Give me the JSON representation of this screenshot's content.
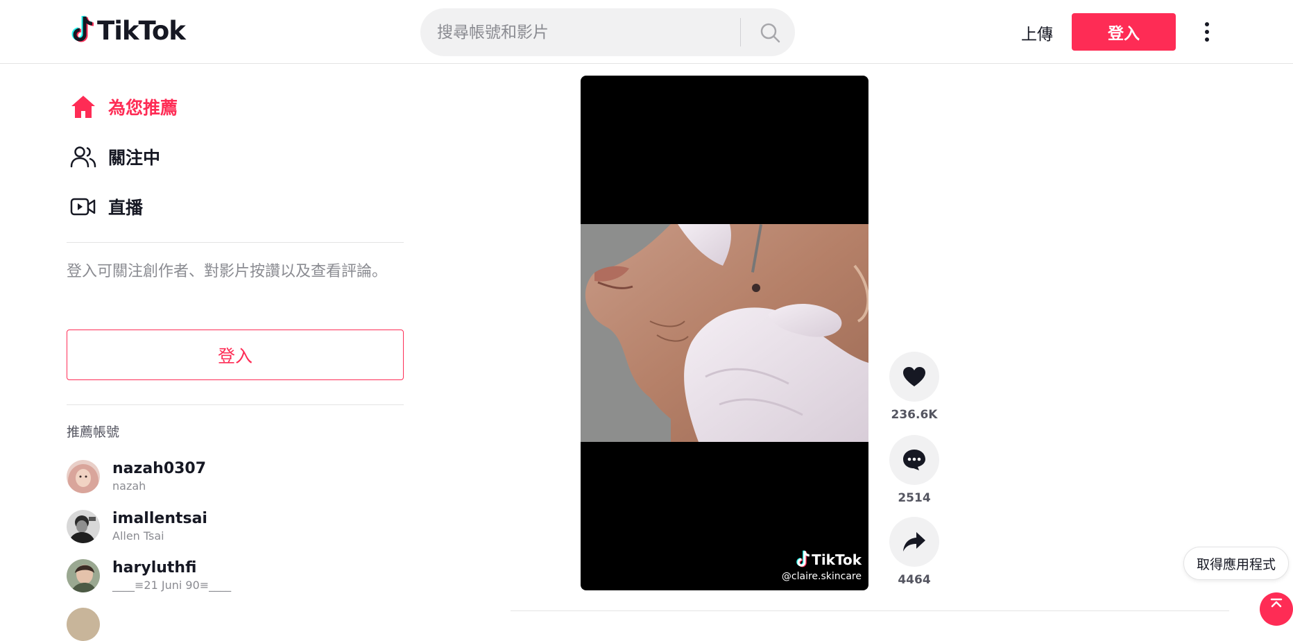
{
  "header": {
    "logo_text": "TikTok",
    "search_placeholder": "搜尋帳號和影片",
    "upload_label": "上傳",
    "login_label": "登入"
  },
  "sidebar": {
    "nav": [
      {
        "label": "為您推薦",
        "icon": "home-icon",
        "active": true
      },
      {
        "label": "關注中",
        "icon": "users-icon",
        "active": false
      },
      {
        "label": "直播",
        "icon": "live-video-icon",
        "active": false
      }
    ],
    "login_prompt": "登入可關注創作者、對影片按讚以及查看評論。",
    "login_button": "登入",
    "suggested_title": "推薦帳號",
    "accounts": [
      {
        "username": "nazah0307",
        "nickname": "nazah"
      },
      {
        "username": "imallentsai",
        "nickname": "Allen Tsai"
      },
      {
        "username": "haryluthfi",
        "nickname": "____≡21 Juni 90≡____"
      }
    ]
  },
  "video": {
    "watermark_logo": "TikTok",
    "watermark_handle": "@claire.skincare",
    "likes": "236.6K",
    "comments": "2514",
    "shares": "4464"
  },
  "floating": {
    "get_app": "取得應用程式"
  },
  "colors": {
    "brand": "#fe2c55",
    "text": "#161823",
    "muted": "#8a8b91"
  }
}
